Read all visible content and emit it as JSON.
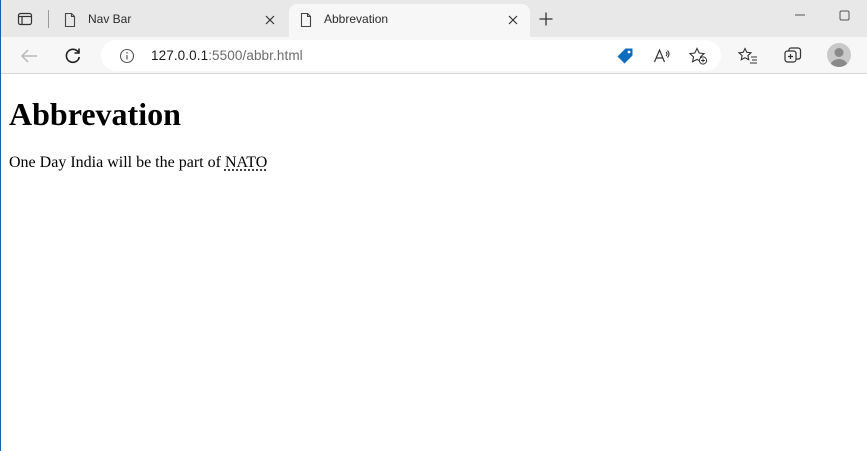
{
  "browser": {
    "tabs": [
      {
        "title": "Nav Bar",
        "active": false
      },
      {
        "title": "Abbrevation",
        "active": true
      }
    ],
    "address": {
      "host": "127.0.0.1",
      "path": ":5500/abbr.html"
    },
    "icons": {
      "tab_actions": "tab-actions-icon",
      "new_tab": "plus-icon",
      "back": "back-arrow-icon",
      "refresh": "refresh-icon",
      "info": "info-icon",
      "tag": "price-tag-icon",
      "read_aloud": "read-aloud-icon",
      "add_favorite": "star-plus-icon",
      "favorites": "favorites-list-icon",
      "collections": "collections-icon",
      "profile": "profile-avatar-icon"
    },
    "colors": {
      "tag_icon": "#0f6cbd",
      "tabstrip_bg": "#e8e8e8",
      "toolbar_bg": "#f7f7f7"
    }
  },
  "page": {
    "heading": "Abbrevation",
    "text_before": "One Day India will be the part of ",
    "abbr": "NATO"
  }
}
